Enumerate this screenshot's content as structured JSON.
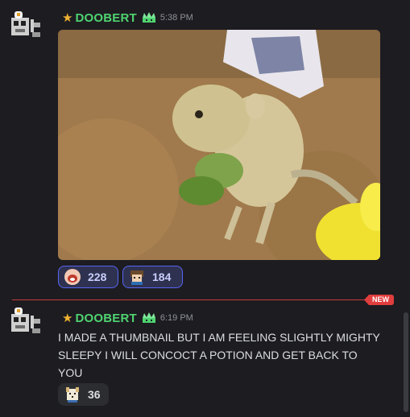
{
  "messages": [
    {
      "author": "DOOBERT",
      "star_icon": "star-icon",
      "badge_icon": "crown-icon",
      "time": "5:38 PM",
      "attachment": "gif-image",
      "reactions": [
        {
          "emoji": "gasp-face-emoji",
          "count": "228",
          "active": true
        },
        {
          "emoji": "pixel-character-emoji",
          "count": "184",
          "active": true
        }
      ]
    },
    {
      "author": "DOOBERT",
      "star_icon": "star-icon",
      "badge_icon": "crown-icon",
      "time": "6:19 PM",
      "text": "I MADE A THUMBNAIL BUT I AM FEELING SLIGHTLY MIGHTY SLEEPY I WILL CONCOCT A POTION AND GET BACK TO YOU",
      "reactions": [
        {
          "emoji": "pixel-dog-emoji",
          "count": "36",
          "active": false
        }
      ]
    }
  ],
  "new_divider": {
    "label": "NEW"
  },
  "colors": {
    "background": "#1d1c21",
    "username": "#4fd470",
    "star": "#f0b232",
    "reaction_active_border": "#5865f2",
    "new_badge": "#e03e3e"
  }
}
